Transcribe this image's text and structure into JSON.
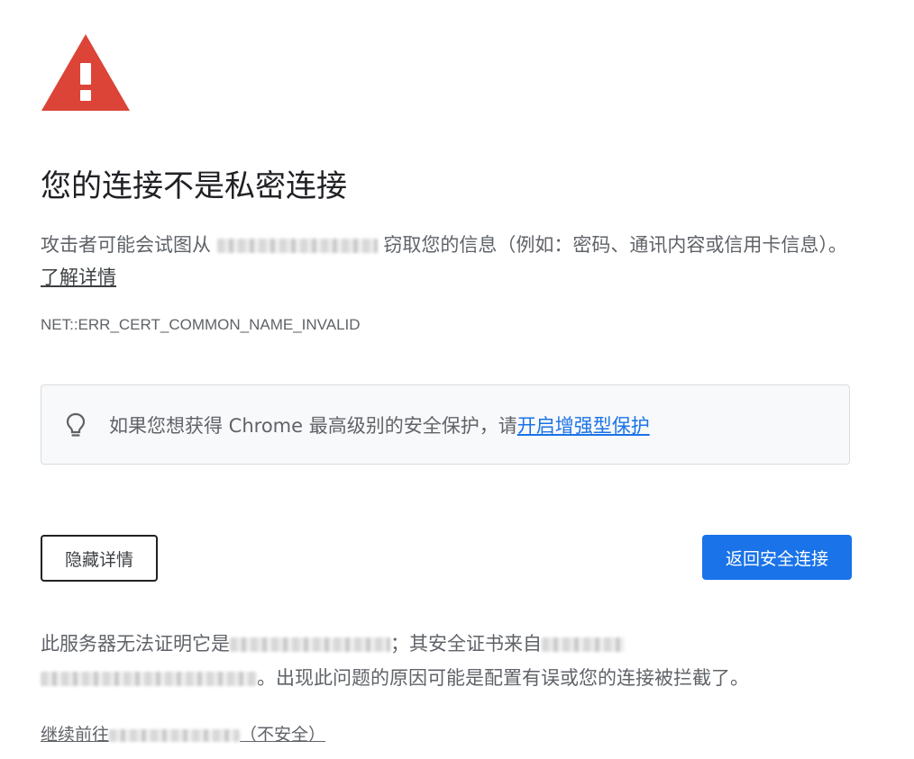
{
  "page": {
    "title": "您的连接不是私密连接",
    "intro_before": "攻击者可能会试图从",
    "intro_after": "窃取您的信息（例如：密码、通讯内容或信用卡信息）。",
    "learn_more": "了解详情",
    "error_code": "NET::ERR_CERT_COMMON_NAME_INVALID"
  },
  "promo": {
    "text": "如果您想获得 Chrome 最高级别的安全保护，请",
    "link": "开启增强型保护"
  },
  "buttons": {
    "hide_details": "隐藏详情",
    "back_to_safety": "返回安全连接"
  },
  "details": {
    "part1": "此服务器无法证明它是",
    "part2": "；其安全证书来自",
    "part3": "。出现此问题的原因可能是配置有误或您的连接被拦截了。"
  },
  "proceed": {
    "before": "继续前往",
    "after": "（不安全）"
  },
  "colors": {
    "warning_red": "#DB4437",
    "primary_blue": "#1A73E8",
    "promo_bg": "#F8F9FA"
  },
  "icons": {
    "warning": "warning-triangle-icon",
    "bulb": "lightbulb-icon"
  }
}
